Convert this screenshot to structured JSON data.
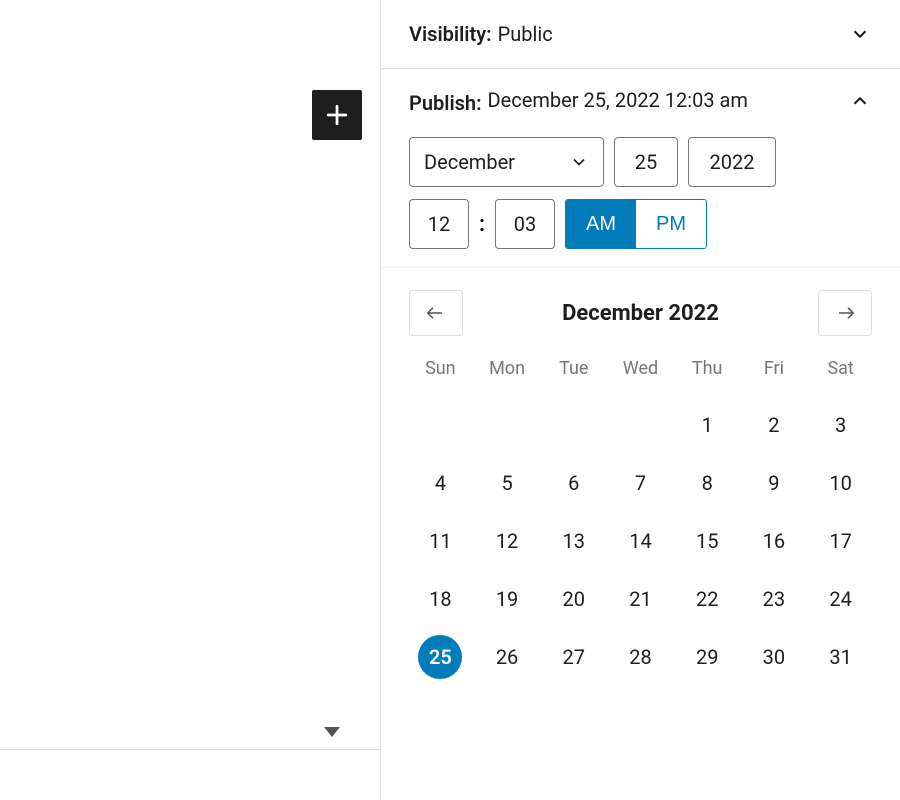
{
  "visibility": {
    "label": "Visibility:",
    "value": "Public"
  },
  "publish": {
    "label": "Publish:",
    "value": "December 25, 2022 12:03 am",
    "month": "December",
    "day": "25",
    "year": "2022",
    "hour": "12",
    "minute": "03",
    "am_label": "AM",
    "pm_label": "PM",
    "period_active": "AM"
  },
  "calendar": {
    "title": "December 2022",
    "weekdays": [
      "Sun",
      "Mon",
      "Tue",
      "Wed",
      "Thu",
      "Fri",
      "Sat"
    ],
    "first_weekday_index": 4,
    "days_in_month": 31,
    "selected_day": 25
  },
  "colors": {
    "accent": "#007cba"
  }
}
